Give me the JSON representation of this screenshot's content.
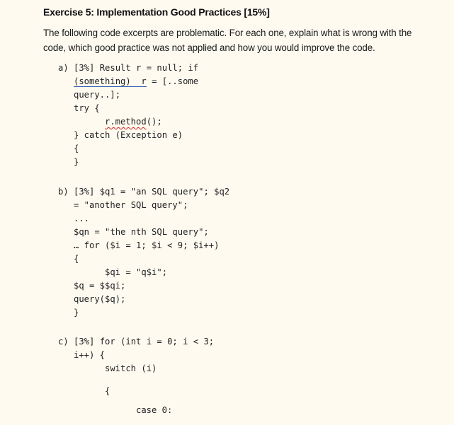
{
  "heading": "Exercise 5: Implementation Good Practices [15%]",
  "intro": "The following code excerpts are problematic. For each one, explain what is wrong with the code, which good practice was not applied and how you would improve the code.",
  "exercises": {
    "a": {
      "label": "a) [3%] Result r = null; if",
      "lines": [
        {
          "pre": "",
          "u": "(something)  r",
          "post": " = [..some"
        },
        "query..];",
        "try {",
        {
          "pre": "",
          "sq": "r.method",
          "post": "();"
        },
        "} catch (Exception e)",
        "{",
        "}"
      ]
    },
    "b": {
      "label": "b) [3%] $q1 = \"an SQL query\"; $q2",
      "lines": [
        "= \"another SQL query\";",
        "...",
        "$qn = \"the nth SQL query\";",
        "… for ($i = 1; $i < 9; $i++)",
        "{",
        "$qi = \"q$i\";",
        "$q = $$qi;",
        "query($q);",
        "}"
      ]
    },
    "c": {
      "label": "c) [3%] for (int i = 0; i < 3;",
      "lines": [
        "i++) {",
        "switch (i)",
        "{",
        "case 0:"
      ]
    }
  }
}
